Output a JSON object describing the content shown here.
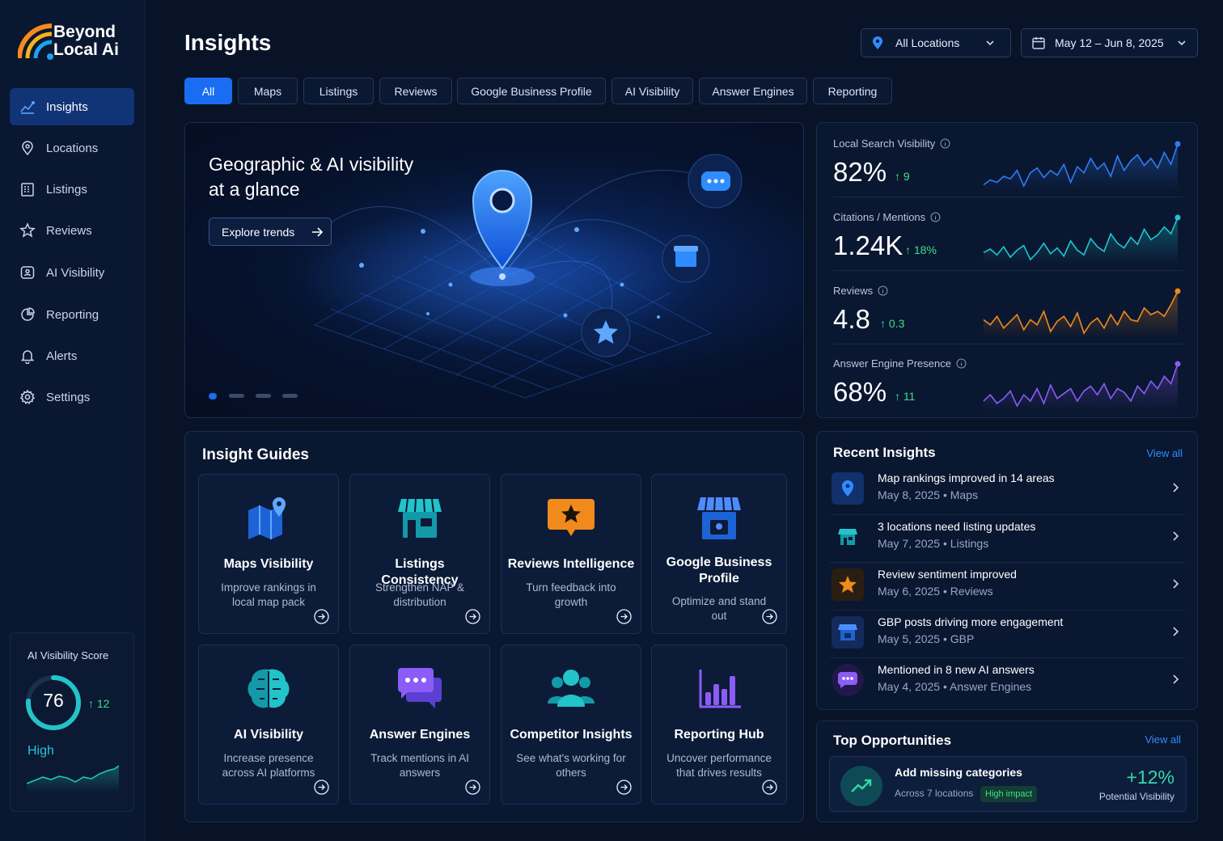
{
  "brand": {
    "name_line1": "Beyond",
    "name_line2": "Local Ai"
  },
  "nav": [
    {
      "label": "Insights",
      "icon": "chart-line-icon",
      "active": true
    },
    {
      "label": "Locations",
      "icon": "location-pin-icon"
    },
    {
      "label": "Listings",
      "icon": "building-icon"
    },
    {
      "label": "Reviews",
      "icon": "star-icon"
    },
    {
      "label": "AI Visibility",
      "icon": "ai-person-icon"
    },
    {
      "label": "Reporting",
      "icon": "pie-chart-icon"
    },
    {
      "label": "Alerts",
      "icon": "bell-icon"
    },
    {
      "label": "Settings",
      "icon": "gear-icon"
    }
  ],
  "score": {
    "title": "AI Visibility Score",
    "value": "76",
    "delta": "12",
    "level": "High",
    "progress": 0.76
  },
  "header": {
    "title": "Insights",
    "location": "All Locations",
    "date_range": "May 12 – Jun 8, 2025"
  },
  "tabs": [
    "All",
    "Maps",
    "Listings",
    "Reviews",
    "Google Business Profile",
    "AI Visibility",
    "Answer Engines",
    "Reporting"
  ],
  "hero": {
    "title": "Geographic & AI visibility at a glance",
    "cta": "Explore trends",
    "slide": 1,
    "slides": 4
  },
  "metrics": [
    {
      "label": "Local Search Visibility",
      "value": "82%",
      "delta": "9",
      "color": "#2f7cf6",
      "series": [
        48,
        52,
        50,
        55,
        53,
        60,
        47,
        58,
        62,
        54,
        60,
        56,
        65,
        50,
        63,
        58,
        70,
        61,
        66,
        55,
        72,
        60,
        68,
        73,
        64,
        70,
        62,
        75,
        65,
        82
      ]
    },
    {
      "label": "Citations / Mentions",
      "value": "1.24K",
      "delta": "18%",
      "color": "#1fc6d1",
      "series": [
        50,
        53,
        48,
        55,
        46,
        52,
        56,
        44,
        50,
        58,
        49,
        54,
        47,
        60,
        52,
        48,
        62,
        55,
        51,
        66,
        58,
        54,
        63,
        57,
        70,
        61,
        65,
        72,
        66,
        80
      ]
    },
    {
      "label": "Reviews",
      "value": "4.8",
      "delta": "0.3",
      "color": "#f08a1c",
      "series": [
        55,
        52,
        57,
        50,
        54,
        58,
        49,
        55,
        52,
        60,
        48,
        54,
        57,
        51,
        59,
        47,
        53,
        56,
        50,
        58,
        52,
        60,
        55,
        54,
        62,
        58,
        60,
        57,
        64,
        72
      ]
    },
    {
      "label": "Answer Engine Presence",
      "value": "68%",
      "delta": "11",
      "color": "#8b5cf6",
      "series": [
        50,
        55,
        48,
        52,
        58,
        46,
        55,
        50,
        60,
        48,
        63,
        52,
        56,
        60,
        50,
        58,
        62,
        55,
        64,
        52,
        60,
        57,
        50,
        62,
        56,
        66,
        60,
        70,
        64,
        80
      ]
    }
  ],
  "guides": {
    "title": "Insight Guides",
    "cards": [
      {
        "title": "Maps Visibility",
        "desc": "Improve rankings in local map pack",
        "icon": "map-pin-icon"
      },
      {
        "title": "Listings Consistency",
        "desc": "Strengthen NAP & distribution",
        "icon": "storefront-icon"
      },
      {
        "title": "Reviews Intelligence",
        "desc": "Turn feedback into growth",
        "icon": "star-chat-icon"
      },
      {
        "title": "Google Business Profile",
        "desc": "Optimize and stand out",
        "icon": "business-profile-icon"
      },
      {
        "title": "AI Visibility",
        "desc": "Increase presence across AI platforms",
        "icon": "brain-icon"
      },
      {
        "title": "Answer Engines",
        "desc": "Track mentions in AI answers",
        "icon": "chat-bubbles-icon"
      },
      {
        "title": "Competitor Insights",
        "desc": "See what's working for others",
        "icon": "people-icon"
      },
      {
        "title": "Reporting Hub",
        "desc": "Uncover performance that drives results",
        "icon": "bar-chart-icon"
      }
    ]
  },
  "recent": {
    "title": "Recent Insights",
    "view_all": "View all",
    "items": [
      {
        "title": "Map rankings improved in 14 areas",
        "date": "May 8, 2025",
        "category": "Maps",
        "icon": "pin-icon"
      },
      {
        "title": "3 locations need listing updates",
        "date": "May 7, 2025",
        "category": "Listings",
        "icon": "store-icon"
      },
      {
        "title": "Review sentiment improved",
        "date": "May 6, 2025",
        "category": "Reviews",
        "icon": "star-icon"
      },
      {
        "title": "GBP posts driving more engagement",
        "date": "May 5, 2025",
        "category": "GBP",
        "icon": "storefront-icon"
      },
      {
        "title": "Mentioned in 8 new AI answers",
        "date": "May 4, 2025",
        "category": "Answer Engines",
        "icon": "chat-icon"
      }
    ]
  },
  "opportunities": {
    "title": "Top Opportunities",
    "view_all": "View all",
    "item": {
      "title": "Add missing categories",
      "sub": "Across 7 locations",
      "badge": "High impact",
      "value": "+12%",
      "value_label": "Potential Visibility",
      "icon": "trend-up-icon"
    }
  },
  "colors": {
    "accent": "#1a6df2",
    "positive": "#3ee08a",
    "teal": "#1fc6d1",
    "orange": "#f08a1c",
    "purple": "#8b5cf6",
    "background": "#081327"
  }
}
